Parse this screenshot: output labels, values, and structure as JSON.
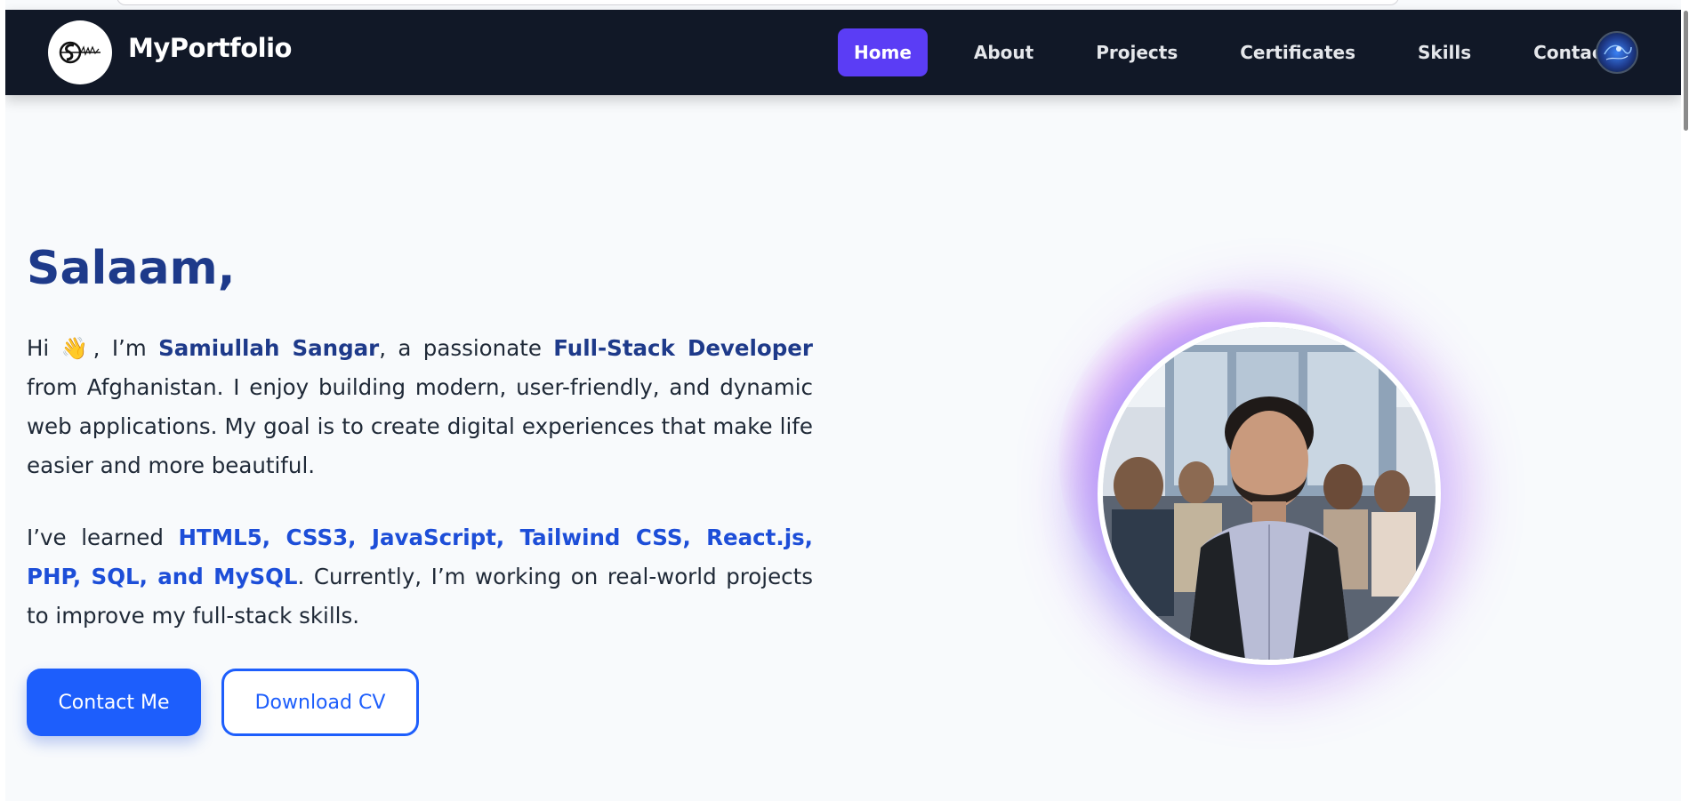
{
  "navbar": {
    "brand": "MyPortfolio",
    "links": [
      "Home",
      "About",
      "Projects",
      "Certificates",
      "Skills",
      "Contact"
    ],
    "active": "Home"
  },
  "hero": {
    "title": "Salaam,",
    "intro": {
      "hi": "Hi ",
      "wave": "👋",
      "im": ", I’m ",
      "name": "Samiullah Sangar",
      "mid": ", a passionate ",
      "role": "Full-Stack Developer",
      "rest": " from Afghanistan. I enjoy building modern, user-friendly, and dynamic web applications. My goal is to create digital experiences that make life easier and more beautiful."
    },
    "skills_para": {
      "lead": "I’ve learned ",
      "skills": "HTML5, CSS3, JavaScript, Tailwind CSS, React.js, PHP, SQL, and MySQL",
      "tail": ". Currently, I’m working on real-world projects to improve my full-stack skills."
    },
    "buttons": {
      "contact": "Contact Me",
      "download": "Download CV"
    }
  },
  "colors": {
    "navbar_bg": "#111827",
    "active_nav": "#5b3df5",
    "primary": "#1d5efc",
    "heading": "#1e3a8a",
    "page_bg": "#f8fafc"
  },
  "icons": {
    "logo": "signature-logo-icon",
    "avatar": "profile-avatar-icon"
  }
}
